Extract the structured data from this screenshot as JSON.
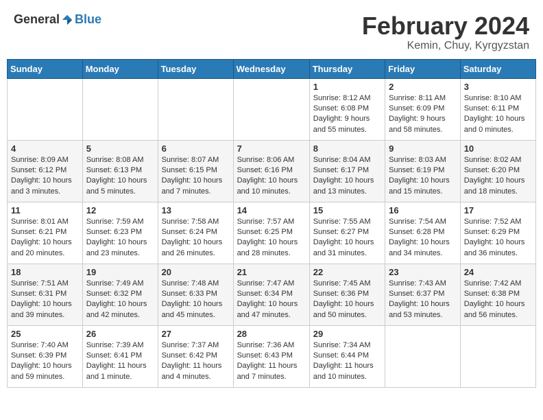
{
  "header": {
    "logo_general": "General",
    "logo_blue": "Blue",
    "month": "February 2024",
    "location": "Kemin, Chuy, Kyrgyzstan"
  },
  "days_of_week": [
    "Sunday",
    "Monday",
    "Tuesday",
    "Wednesday",
    "Thursday",
    "Friday",
    "Saturday"
  ],
  "weeks": [
    [
      {
        "day": "",
        "info": ""
      },
      {
        "day": "",
        "info": ""
      },
      {
        "day": "",
        "info": ""
      },
      {
        "day": "",
        "info": ""
      },
      {
        "day": "1",
        "info": "Sunrise: 8:12 AM\nSunset: 6:08 PM\nDaylight: 9 hours and 55 minutes."
      },
      {
        "day": "2",
        "info": "Sunrise: 8:11 AM\nSunset: 6:09 PM\nDaylight: 9 hours and 58 minutes."
      },
      {
        "day": "3",
        "info": "Sunrise: 8:10 AM\nSunset: 6:11 PM\nDaylight: 10 hours and 0 minutes."
      }
    ],
    [
      {
        "day": "4",
        "info": "Sunrise: 8:09 AM\nSunset: 6:12 PM\nDaylight: 10 hours and 3 minutes."
      },
      {
        "day": "5",
        "info": "Sunrise: 8:08 AM\nSunset: 6:13 PM\nDaylight: 10 hours and 5 minutes."
      },
      {
        "day": "6",
        "info": "Sunrise: 8:07 AM\nSunset: 6:15 PM\nDaylight: 10 hours and 7 minutes."
      },
      {
        "day": "7",
        "info": "Sunrise: 8:06 AM\nSunset: 6:16 PM\nDaylight: 10 hours and 10 minutes."
      },
      {
        "day": "8",
        "info": "Sunrise: 8:04 AM\nSunset: 6:17 PM\nDaylight: 10 hours and 13 minutes."
      },
      {
        "day": "9",
        "info": "Sunrise: 8:03 AM\nSunset: 6:19 PM\nDaylight: 10 hours and 15 minutes."
      },
      {
        "day": "10",
        "info": "Sunrise: 8:02 AM\nSunset: 6:20 PM\nDaylight: 10 hours and 18 minutes."
      }
    ],
    [
      {
        "day": "11",
        "info": "Sunrise: 8:01 AM\nSunset: 6:21 PM\nDaylight: 10 hours and 20 minutes."
      },
      {
        "day": "12",
        "info": "Sunrise: 7:59 AM\nSunset: 6:23 PM\nDaylight: 10 hours and 23 minutes."
      },
      {
        "day": "13",
        "info": "Sunrise: 7:58 AM\nSunset: 6:24 PM\nDaylight: 10 hours and 26 minutes."
      },
      {
        "day": "14",
        "info": "Sunrise: 7:57 AM\nSunset: 6:25 PM\nDaylight: 10 hours and 28 minutes."
      },
      {
        "day": "15",
        "info": "Sunrise: 7:55 AM\nSunset: 6:27 PM\nDaylight: 10 hours and 31 minutes."
      },
      {
        "day": "16",
        "info": "Sunrise: 7:54 AM\nSunset: 6:28 PM\nDaylight: 10 hours and 34 minutes."
      },
      {
        "day": "17",
        "info": "Sunrise: 7:52 AM\nSunset: 6:29 PM\nDaylight: 10 hours and 36 minutes."
      }
    ],
    [
      {
        "day": "18",
        "info": "Sunrise: 7:51 AM\nSunset: 6:31 PM\nDaylight: 10 hours and 39 minutes."
      },
      {
        "day": "19",
        "info": "Sunrise: 7:49 AM\nSunset: 6:32 PM\nDaylight: 10 hours and 42 minutes."
      },
      {
        "day": "20",
        "info": "Sunrise: 7:48 AM\nSunset: 6:33 PM\nDaylight: 10 hours and 45 minutes."
      },
      {
        "day": "21",
        "info": "Sunrise: 7:47 AM\nSunset: 6:34 PM\nDaylight: 10 hours and 47 minutes."
      },
      {
        "day": "22",
        "info": "Sunrise: 7:45 AM\nSunset: 6:36 PM\nDaylight: 10 hours and 50 minutes."
      },
      {
        "day": "23",
        "info": "Sunrise: 7:43 AM\nSunset: 6:37 PM\nDaylight: 10 hours and 53 minutes."
      },
      {
        "day": "24",
        "info": "Sunrise: 7:42 AM\nSunset: 6:38 PM\nDaylight: 10 hours and 56 minutes."
      }
    ],
    [
      {
        "day": "25",
        "info": "Sunrise: 7:40 AM\nSunset: 6:39 PM\nDaylight: 10 hours and 59 minutes."
      },
      {
        "day": "26",
        "info": "Sunrise: 7:39 AM\nSunset: 6:41 PM\nDaylight: 11 hours and 1 minute."
      },
      {
        "day": "27",
        "info": "Sunrise: 7:37 AM\nSunset: 6:42 PM\nDaylight: 11 hours and 4 minutes."
      },
      {
        "day": "28",
        "info": "Sunrise: 7:36 AM\nSunset: 6:43 PM\nDaylight: 11 hours and 7 minutes."
      },
      {
        "day": "29",
        "info": "Sunrise: 7:34 AM\nSunset: 6:44 PM\nDaylight: 11 hours and 10 minutes."
      },
      {
        "day": "",
        "info": ""
      },
      {
        "day": "",
        "info": ""
      }
    ]
  ]
}
